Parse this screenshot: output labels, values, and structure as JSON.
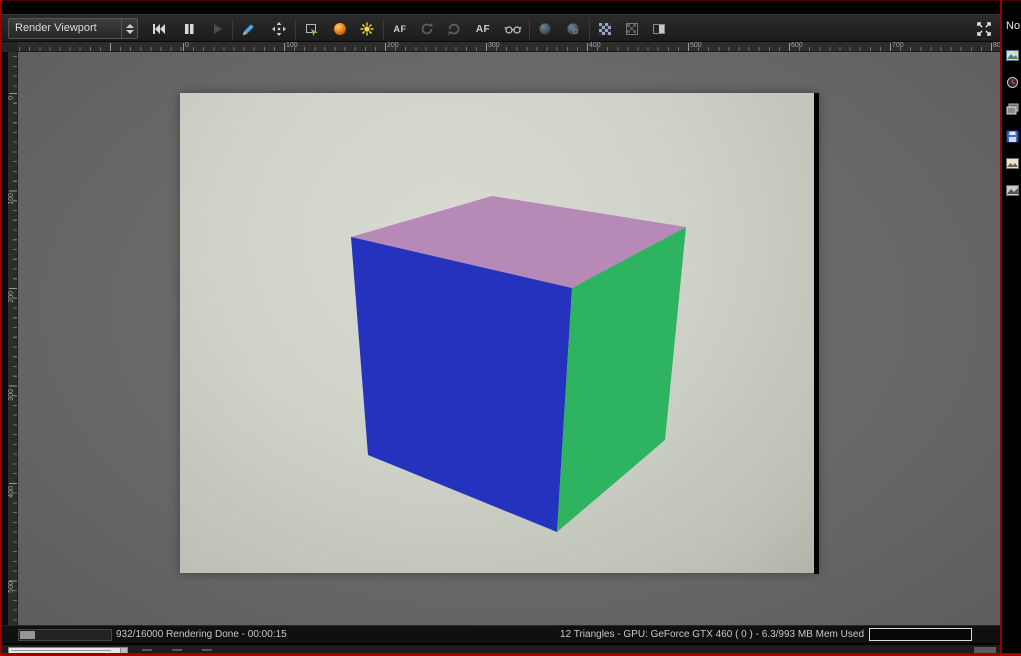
{
  "toolbar": {
    "viewport_selector_label": "Render Viewport",
    "af_tonemap_label": "AF",
    "af_label": "AF",
    "icons": [
      "skip-to-start",
      "pause",
      "play",
      "pen",
      "pan",
      "frame-snapshot",
      "material-ball",
      "firefly",
      "refresh-a",
      "refresh-b",
      "glasses",
      "orb-a",
      "orb-b",
      "checkerboard",
      "checkerboard-outline",
      "split-view",
      "fullscreen"
    ]
  },
  "right_panel": {
    "title_truncated": "No",
    "icons": [
      "image",
      "history",
      "layers",
      "save",
      "gallery",
      "adjustments"
    ]
  },
  "rulers": {
    "top_labels": [
      "0",
      "100",
      "200",
      "300",
      "400",
      "500",
      "600",
      "700",
      "80"
    ],
    "left_labels": [
      "0",
      "100",
      "200",
      "300",
      "400",
      "500"
    ]
  },
  "render": {
    "background_color": "#cfd2c8",
    "cube": {
      "top_color": "#b689b7",
      "left_color": "#2432bd",
      "right_color": "#2eb360"
    }
  },
  "status_bar": {
    "progress_left_label": "932/16000 Rendering Done - 00:00:15",
    "stats_right_label": "12 Triangles - GPU: GeForce GTX 460 ( 0 ) - 6.3/993 MB Mem Used"
  }
}
